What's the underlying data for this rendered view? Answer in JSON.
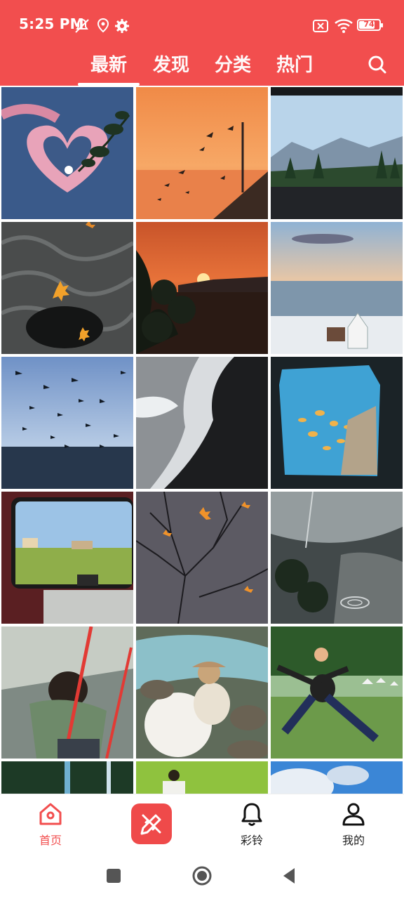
{
  "status_bar": {
    "time": "5:25 PM",
    "battery": "74"
  },
  "tabs": [
    {
      "label": "最新",
      "active": true
    },
    {
      "label": "发现",
      "active": false
    },
    {
      "label": "分类",
      "active": false
    },
    {
      "label": "热门",
      "active": false
    }
  ],
  "grid": {
    "items": [
      {
        "name": "heart-clouds-image"
      },
      {
        "name": "sunset-birds-image"
      },
      {
        "name": "train-window-mountains-image"
      },
      {
        "name": "autumn-leaves-water-image"
      },
      {
        "name": "red-sunset-image"
      },
      {
        "name": "sea-horizon-image"
      },
      {
        "name": "seagulls-image"
      },
      {
        "name": "black-sand-wave-image"
      },
      {
        "name": "aquarium-window-image"
      },
      {
        "name": "train-window-field-image"
      },
      {
        "name": "leaves-reflection-image"
      },
      {
        "name": "umbrella-rain-image"
      },
      {
        "name": "swing-girl-image"
      },
      {
        "name": "dog-river-image"
      },
      {
        "name": "jumping-person-image"
      },
      {
        "name": "forest-image"
      },
      {
        "name": "girl-field-image"
      },
      {
        "name": "blue-sky-clouds-image"
      }
    ]
  },
  "bottom_nav": {
    "home_label": "首页",
    "ringtone_label": "彩铃",
    "mine_label": "我的"
  },
  "colors": {
    "accent": "#f24e4e"
  }
}
